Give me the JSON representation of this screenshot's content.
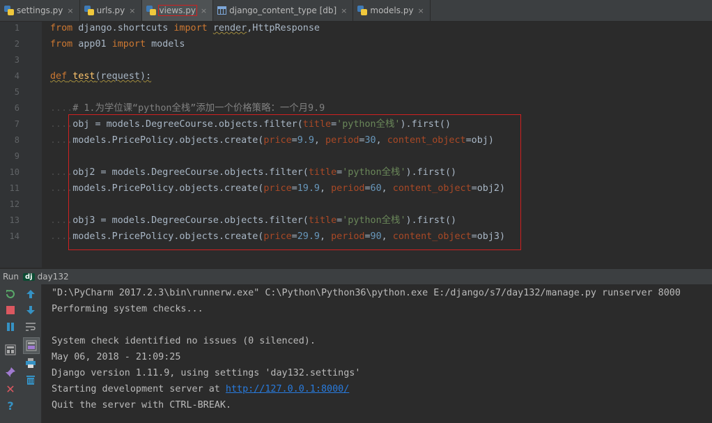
{
  "tabs": [
    {
      "label": "settings.py",
      "icon": "python-file-icon",
      "active": false
    },
    {
      "label": "urls.py",
      "icon": "python-file-icon",
      "active": false
    },
    {
      "label": "views.py",
      "icon": "python-file-icon",
      "active": true
    },
    {
      "label": "django_content_type [db]",
      "icon": "db-table-icon",
      "active": false
    },
    {
      "label": "models.py",
      "icon": "python-file-icon",
      "active": false
    }
  ],
  "tab_close_glyph": "×",
  "line_numbers": [
    "1",
    "2",
    "3",
    "4",
    "5",
    "6",
    "7",
    "8",
    "9",
    "10",
    "11",
    "12",
    "13",
    "14"
  ],
  "code": {
    "l1": {
      "kw1": "from",
      "mod": " django.shortcuts ",
      "kw2": "import",
      "sp": " ",
      "imp1": "render",
      "comma": ",",
      "imp2": "HttpResponse"
    },
    "l2": {
      "kw1": "from",
      "mod": " app01 ",
      "kw2": "import",
      "rest": " models"
    },
    "l4": {
      "kw": "def",
      "sp": " ",
      "name": "test",
      "rest": "(request):"
    },
    "l6": {
      "dots": "....",
      "comment": "# 1.为学位课“python全栈”添加一个价格策略：一个月9.9"
    },
    "l7": {
      "dots": "....",
      "a": "obj = models.DegreeCourse.objects.filter(",
      "p": "title",
      "eq": "=",
      "s": "'python全栈'",
      "b": ").first()"
    },
    "l8": {
      "dots": "....",
      "a": "models.PricePolicy.objects.create(",
      "p1": "price",
      "v1": "9.9",
      "p2": "period",
      "v2": "30",
      "p3": "content_object",
      "v3": "obj",
      "end": ")"
    },
    "l10": {
      "dots": "....",
      "a": "obj2 = models.DegreeCourse.objects.filter(",
      "p": "title",
      "eq": "=",
      "s": "'python全栈'",
      "b": ").first()"
    },
    "l11": {
      "dots": "....",
      "a": "models.PricePolicy.objects.create(",
      "p1": "price",
      "v1": "19.9",
      "p2": "period",
      "v2": "60",
      "p3": "content_object",
      "v3": "obj2",
      "end": ")"
    },
    "l13": {
      "dots": "....",
      "a": "obj3 = models.DegreeCourse.objects.filter(",
      "p": "title",
      "eq": "=",
      "s": "'python全栈'",
      "b": ").first()"
    },
    "l14": {
      "dots": "....",
      "a": "models.PricePolicy.objects.create(",
      "p1": "price",
      "v1": "29.9",
      "p2": "period",
      "v2": "90",
      "p3": "content_object",
      "v3": "obj3",
      "end": ")"
    }
  },
  "run_panel": {
    "run_label": "Run",
    "config_badge": "dj",
    "config_name": "day132",
    "tools_left": [
      "rerun-icon",
      "stop-icon",
      "pause-icon",
      "layout-icon",
      "pin-icon",
      "close-icon",
      "help-icon"
    ],
    "tools_right": [
      "up-arrow-icon",
      "down-arrow-icon",
      "soft-wrap-icon",
      "scroll-to-end-icon",
      "print-icon",
      "trash-icon"
    ]
  },
  "console": {
    "lines": [
      "\"D:\\PyCharm 2017.2.3\\bin\\runnerw.exe\" C:\\Python\\Python36\\python.exe E:/django/s7/day132/manage.py runserver 8000",
      "Performing system checks...",
      "",
      "System check identified no issues (0 silenced).",
      "May 06, 2018 - 21:09:25",
      "Django version 1.11.9, using settings 'day132.settings'"
    ],
    "start_prefix": "Starting development server at ",
    "url": "http://127.0.0.1:8000/",
    "quit_line": "Quit the server with CTRL-BREAK."
  },
  "colors": {
    "keyword": "#cc7832",
    "string": "#6a8759",
    "number": "#6897bb",
    "param": "#aa4926",
    "function": "#ffc66d",
    "comment": "#808080",
    "highlight_border": "#d02020",
    "link": "#287bde"
  }
}
